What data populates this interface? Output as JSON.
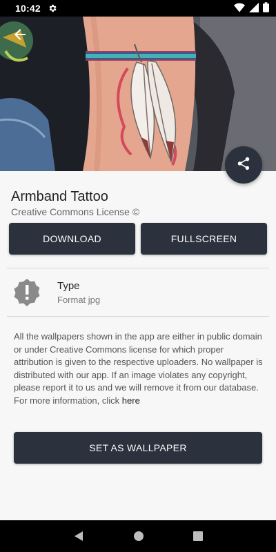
{
  "status_bar": {
    "time": "10:42",
    "icons": [
      "gear-icon",
      "wifi-icon",
      "signal-icon",
      "battery-icon"
    ]
  },
  "hero": {
    "description_icon": "tattoo-photo",
    "back_icon": "arrow-left-icon"
  },
  "share": {
    "icon": "share-icon"
  },
  "detail": {
    "title": "Armband Tattoo",
    "license": "Creative Commons License ©"
  },
  "actions": {
    "download_label": "DOWNLOAD",
    "fullscreen_label": "FULLSCREEN",
    "set_wallpaper_label": "SET AS WALLPAPER"
  },
  "info": {
    "icon": "alert-badge-icon",
    "label": "Type",
    "value": "Format jpg"
  },
  "disclaimer": {
    "text": "All the wallpapers shown in the app are either in public domain or under Creative Commons license for which proper attribution is given to the respective uploaders. No wallpaper is distributed with our app. If an image violates any copyright, please report it to us and we will remove it from our database. For more information, click",
    "link_text": "here"
  },
  "nav": {
    "icons": [
      "back-triangle-icon",
      "home-circle-icon",
      "recents-square-icon"
    ]
  },
  "colors": {
    "button_bg": "#2b323d",
    "button_text": "#ffffff",
    "background": "#f7f7f7"
  }
}
